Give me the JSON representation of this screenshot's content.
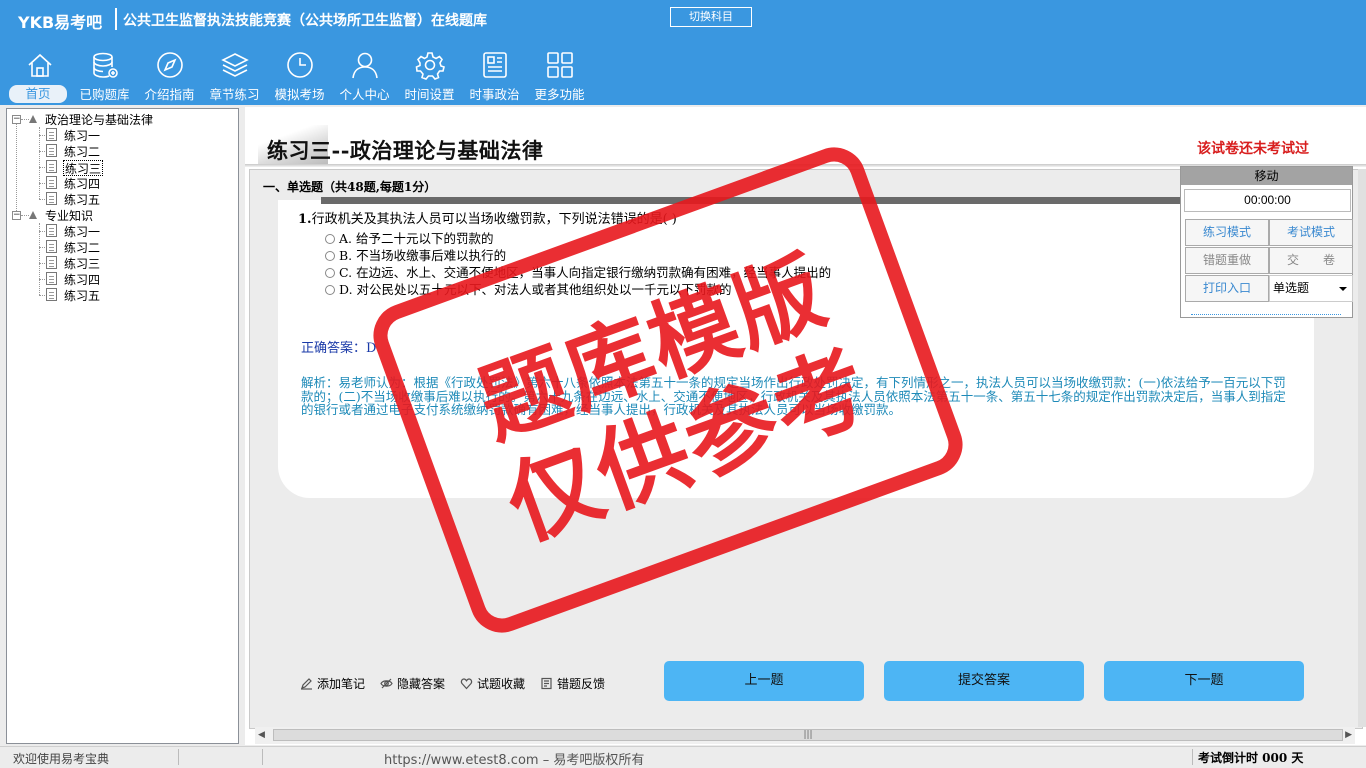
{
  "header": {
    "logo": "YKB易考吧",
    "title": "公共卫生监督执法技能竞赛（公共场所卫生监督）在线题库",
    "switch_label": "切换科目",
    "nav": [
      {
        "label": "首页",
        "icon": "home-icon"
      },
      {
        "label": "已购题库",
        "icon": "database-icon"
      },
      {
        "label": "介绍指南",
        "icon": "compass-icon"
      },
      {
        "label": "章节练习",
        "icon": "layers-icon"
      },
      {
        "label": "模拟考场",
        "icon": "clock-icon"
      },
      {
        "label": "个人中心",
        "icon": "user-icon"
      },
      {
        "label": "时间设置",
        "icon": "gear-icon"
      },
      {
        "label": "时事政治",
        "icon": "news-icon"
      },
      {
        "label": "更多功能",
        "icon": "grid-icon"
      }
    ]
  },
  "tree": {
    "groups": [
      {
        "label": "政治理论与基础法律",
        "items": [
          "练习一",
          "练习二",
          "练习三",
          "练习四",
          "练习五"
        ]
      },
      {
        "label": "专业知识",
        "items": [
          "练习一",
          "练习二",
          "练习三",
          "练习四",
          "练习五"
        ]
      }
    ]
  },
  "exam": {
    "title": "练习三--政治理论与基础法律",
    "status": "该试卷还未考试过",
    "section": "一、单选题（共48题,每题1分）",
    "question_number": "1.",
    "question": "行政机关及其执法人员可以当场收缴罚款，下列说法错误的是(    )",
    "options": [
      "A. 给予二十元以下的罚款的",
      "B. 不当场收缴事后难以执行的",
      "C. 在边远、水上、交通不便地区，当事人向指定银行缴纳罚款确有困难，经当事人提出的",
      "D. 对公民处以五十元以下、对法人或者其他组织处以一千元以下罚款的"
    ],
    "answer": "正确答案：D",
    "analysis": "解析：易老师认为：根据《行政处罚法》第六十八条依照本法第五十一条的规定当场作出行政处罚决定，有下列情形之一，执法人员可以当场收缴罚款：(一)依法给予一百元以下罚款的；(二)不当场收缴事后难以执行的。第六十九条在边远、水上、交通不便地区，行政机关及其执法人员依照本法第五十一条、第五十七条的规定作出罚款决定后，当事人到指定的银行或者通过电子支付系统缴纳罚款确有困难，经当事人提出，行政机关及其执法人员可以当场收缴罚款。"
  },
  "toolbar": {
    "note": "添加笔记",
    "hide_answer": "隐藏答案",
    "favorite": "试题收藏",
    "feedback": "错题反馈",
    "prev": "上一题",
    "submit": "提交答案",
    "next": "下一题"
  },
  "float_panel": {
    "title": "移动",
    "timer": "00:00:00",
    "practice_mode": "练习模式",
    "exam_mode": "考试模式",
    "redo_wrong": "错题重做",
    "submit_paper": "交　　卷",
    "print": "打印入口",
    "type_select": "单选题"
  },
  "statusbar": {
    "welcome": "欢迎使用易考宝典",
    "copyright": "https://www.etest8.com – 易考吧版权所有",
    "countdown": "考试倒计时 000 天"
  },
  "watermark": {
    "line1": "题库模版",
    "line2": "仅供参考"
  },
  "colors": {
    "header_bg": "#3a97e0",
    "stamp_red": "#e8181d",
    "button_blue": "#4db5f4",
    "status_red": "#d81e1e"
  }
}
